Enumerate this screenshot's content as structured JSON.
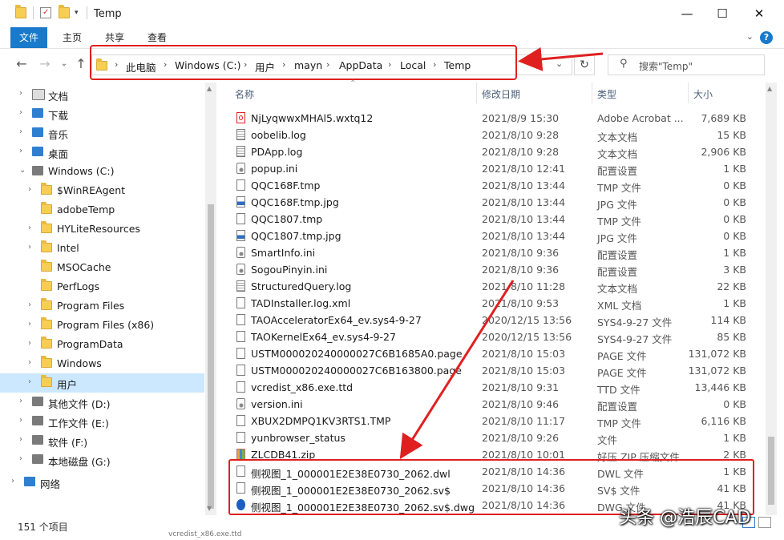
{
  "window": {
    "title": "Temp",
    "minimize": "—",
    "maximize": "☐",
    "close": "✕"
  },
  "ribbon": {
    "tabs": [
      {
        "label": "文件",
        "active": true
      },
      {
        "label": "主页",
        "active": false
      },
      {
        "label": "共享",
        "active": false
      },
      {
        "label": "查看",
        "active": false
      }
    ],
    "help": "?"
  },
  "address": {
    "crumbs": [
      "此电脑",
      "Windows (C:)",
      "用户",
      "mayn",
      "AppData",
      "Local",
      "Temp"
    ],
    "search_placeholder": "搜索\"Temp\""
  },
  "sidebar": {
    "items": [
      {
        "label": "文档",
        "icon": "document-icon",
        "level": 1,
        "expand": "›"
      },
      {
        "label": "下载",
        "icon": "download-icon",
        "level": 1,
        "expand": "›"
      },
      {
        "label": "音乐",
        "icon": "music-icon",
        "level": 1,
        "expand": "›"
      },
      {
        "label": "桌面",
        "icon": "desktop-icon",
        "level": 1,
        "expand": "›"
      },
      {
        "label": "Windows (C:)",
        "icon": "drive-icon",
        "level": 1,
        "expand": "⌄"
      },
      {
        "label": "$WinREAgent",
        "icon": "folder-icon",
        "level": 2,
        "expand": "›"
      },
      {
        "label": "adobeTemp",
        "icon": "folder-icon",
        "level": 2,
        "expand": ""
      },
      {
        "label": "HYLiteResources",
        "icon": "folder-icon",
        "level": 2,
        "expand": "›"
      },
      {
        "label": "Intel",
        "icon": "folder-icon",
        "level": 2,
        "expand": "›"
      },
      {
        "label": "MSOCache",
        "icon": "folder-icon",
        "level": 2,
        "expand": ""
      },
      {
        "label": "PerfLogs",
        "icon": "folder-icon",
        "level": 2,
        "expand": ""
      },
      {
        "label": "Program Files",
        "icon": "folder-icon",
        "level": 2,
        "expand": "›"
      },
      {
        "label": "Program Files (x86)",
        "icon": "folder-icon",
        "level": 2,
        "expand": "›"
      },
      {
        "label": "ProgramData",
        "icon": "folder-icon",
        "level": 2,
        "expand": "›"
      },
      {
        "label": "Windows",
        "icon": "folder-icon",
        "level": 2,
        "expand": "›"
      },
      {
        "label": "用户",
        "icon": "folder-icon",
        "level": 2,
        "expand": "›",
        "selected": true
      },
      {
        "label": "其他文件 (D:)",
        "icon": "drive-icon",
        "level": 1,
        "expand": "›"
      },
      {
        "label": "工作文件 (E:)",
        "icon": "drive-icon",
        "level": 1,
        "expand": "›"
      },
      {
        "label": "软件 (F:)",
        "icon": "drive-icon",
        "level": 1,
        "expand": "›"
      },
      {
        "label": "本地磁盘 (G:)",
        "icon": "drive-icon",
        "level": 1,
        "expand": "›"
      },
      {
        "label": "网络",
        "icon": "network-icon",
        "level": 0,
        "expand": "›"
      }
    ]
  },
  "columns": {
    "name": "名称",
    "date": "修改日期",
    "type": "类型",
    "size": "大小"
  },
  "files": [
    {
      "name": "NjLyqwwxMHAl5.wxtq12",
      "date": "2021/8/9 15:30",
      "type": "Adobe Acrobat ...",
      "size": "7,689 KB",
      "icon": "pdf"
    },
    {
      "name": "oobelib.log",
      "date": "2021/8/10 9:28",
      "type": "文本文档",
      "size": "15 KB",
      "icon": "lines"
    },
    {
      "name": "PDApp.log",
      "date": "2021/8/10 9:28",
      "type": "文本文档",
      "size": "2,906 KB",
      "icon": "lines"
    },
    {
      "name": "popup.ini",
      "date": "2021/8/10 12:41",
      "type": "配置设置",
      "size": "1 KB",
      "icon": "cfg"
    },
    {
      "name": "QQC168F.tmp",
      "date": "2021/8/10 13:44",
      "type": "TMP 文件",
      "size": "0 KB",
      "icon": "blank"
    },
    {
      "name": "QQC168F.tmp.jpg",
      "date": "2021/8/10 13:44",
      "type": "JPG 文件",
      "size": "0 KB",
      "icon": "img"
    },
    {
      "name": "QQC1807.tmp",
      "date": "2021/8/10 13:44",
      "type": "TMP 文件",
      "size": "0 KB",
      "icon": "blank"
    },
    {
      "name": "QQC1807.tmp.jpg",
      "date": "2021/8/10 13:44",
      "type": "JPG 文件",
      "size": "0 KB",
      "icon": "img"
    },
    {
      "name": "SmartInfo.ini",
      "date": "2021/8/10 9:36",
      "type": "配置设置",
      "size": "1 KB",
      "icon": "cfg"
    },
    {
      "name": "SogouPinyin.ini",
      "date": "2021/8/10 9:36",
      "type": "配置设置",
      "size": "3 KB",
      "icon": "cfg"
    },
    {
      "name": "StructuredQuery.log",
      "date": "2021/8/10 11:28",
      "type": "文本文档",
      "size": "22 KB",
      "icon": "lines"
    },
    {
      "name": "TADInstaller.log.xml",
      "date": "2021/8/10 9:53",
      "type": "XML 文档",
      "size": "1 KB",
      "icon": "blank"
    },
    {
      "name": "TAOAcceleratorEx64_ev.sys4-9-27",
      "date": "2020/12/15 13:56",
      "type": "SYS4-9-27 文件",
      "size": "114 KB",
      "icon": "blank"
    },
    {
      "name": "TAOKernelEx64_ev.sys4-9-27",
      "date": "2020/12/15 13:56",
      "type": "SYS4-9-27 文件",
      "size": "85 KB",
      "icon": "blank"
    },
    {
      "name": "USTM000020240000027C6B1685A0.page",
      "date": "2021/8/10 15:03",
      "type": "PAGE 文件",
      "size": "131,072 KB",
      "icon": "blank"
    },
    {
      "name": "USTM000020240000027C6B163800.page",
      "date": "2021/8/10 15:03",
      "type": "PAGE 文件",
      "size": "131,072 KB",
      "icon": "blank"
    },
    {
      "name": "vcredist_x86.exe.ttd",
      "date": "2021/8/10 9:31",
      "type": "TTD 文件",
      "size": "13,446 KB",
      "icon": "blank"
    },
    {
      "name": "version.ini",
      "date": "2021/8/10 9:46",
      "type": "配置设置",
      "size": "0 KB",
      "icon": "cfg"
    },
    {
      "name": "XBUX2DMPQ1KV3RTS1.TMP",
      "date": "2021/8/10 11:17",
      "type": "TMP 文件",
      "size": "6,116 KB",
      "icon": "blank"
    },
    {
      "name": "yunbrowser_status",
      "date": "2021/8/10 9:26",
      "type": "文件",
      "size": "1 KB",
      "icon": "blank"
    },
    {
      "name": "ZLCDB41.zip",
      "date": "2021/8/10 10:01",
      "type": "好压 ZIP 压缩文件",
      "size": "2 KB",
      "icon": "zip"
    },
    {
      "name": "侧视图_1_000001E2E38E0730_2062.dwl",
      "date": "2021/8/10 14:36",
      "type": "DWL 文件",
      "size": "1 KB",
      "icon": "blank"
    },
    {
      "name": "侧视图_1_000001E2E38E0730_2062.sv$",
      "date": "2021/8/10 14:36",
      "type": "SV$ 文件",
      "size": "41 KB",
      "icon": "blank"
    },
    {
      "name": "侧视图_1_000001E2E38E0730_2062.sv$.dwg",
      "date": "2021/8/10 14:36",
      "type": "DWG 文件",
      "size": "41 KB",
      "icon": "dwg"
    }
  ],
  "status": {
    "count": "151 个项目"
  },
  "watermark": "头条 @浩辰CAD",
  "ghost_row": "vcredist_x86.exe.ttd",
  "colors": {
    "accent": "#1979ca",
    "annotation": "#e02020",
    "selection": "#cce8ff"
  }
}
